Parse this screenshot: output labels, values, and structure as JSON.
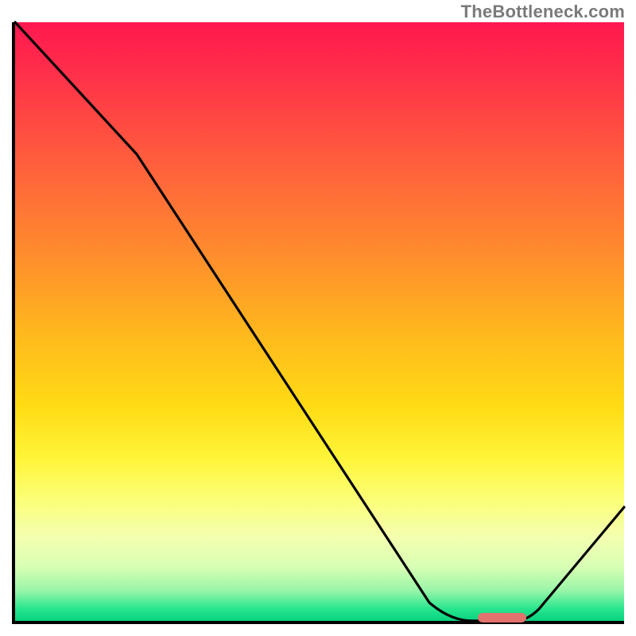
{
  "watermark": "TheBottleneck.com",
  "chart_data": {
    "type": "line",
    "title": "",
    "xlabel": "",
    "ylabel": "",
    "xlim": [
      0,
      100
    ],
    "ylim": [
      0,
      100
    ],
    "grid": false,
    "legend": false,
    "gradient_stops": [
      {
        "pct": 0,
        "color": "#ff1850"
      },
      {
        "pct": 8,
        "color": "#ff2e4a"
      },
      {
        "pct": 22,
        "color": "#ff5a3e"
      },
      {
        "pct": 38,
        "color": "#ff8a2e"
      },
      {
        "pct": 52,
        "color": "#ffb81e"
      },
      {
        "pct": 64,
        "color": "#ffdb14"
      },
      {
        "pct": 73,
        "color": "#fff53a"
      },
      {
        "pct": 80,
        "color": "#fbff7a"
      },
      {
        "pct": 86,
        "color": "#f4ffb0"
      },
      {
        "pct": 91,
        "color": "#d8ffb4"
      },
      {
        "pct": 95,
        "color": "#97f5a8"
      },
      {
        "pct": 98,
        "color": "#28e58e"
      },
      {
        "pct": 100,
        "color": "#06d27e"
      }
    ],
    "series": [
      {
        "name": "bottleneck-curve",
        "x": [
          0,
          20,
          68,
          75,
          82,
          86,
          100
        ],
        "y": [
          100,
          78,
          3,
          0,
          0,
          2,
          19
        ]
      }
    ],
    "marker": {
      "name": "optimal-range",
      "x_start": 76,
      "x_end": 84,
      "y": 0,
      "color": "#e2726e"
    }
  }
}
